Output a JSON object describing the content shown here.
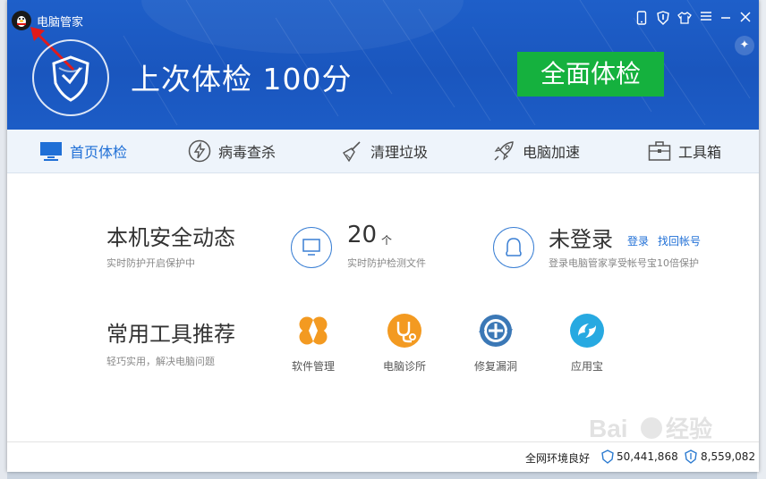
{
  "app": {
    "title": "电脑管家",
    "window_buttons": [
      "phone-icon",
      "shield-icon",
      "shirt-icon",
      "menu-icon",
      "minimize-icon",
      "close-icon"
    ]
  },
  "header": {
    "score_text": "上次体检 100分",
    "scan_button": "全面体检"
  },
  "tabs": [
    {
      "label": "首页体检",
      "icon": "monitor-icon",
      "active": true
    },
    {
      "label": "病毒查杀",
      "icon": "lightning-icon",
      "active": false
    },
    {
      "label": "清理垃圾",
      "icon": "broom-icon",
      "active": false
    },
    {
      "label": "电脑加速",
      "icon": "rocket-icon",
      "active": false
    },
    {
      "label": "工具箱",
      "icon": "toolbox-icon",
      "active": false
    }
  ],
  "security": {
    "title": "本机安全动态",
    "subtitle": "实时防护开启保护中",
    "file_count": "20",
    "file_unit": "个",
    "file_caption": "实时防护检测文件",
    "login_status": "未登录",
    "login_link": "登录",
    "recover_link": "找回帐号",
    "login_caption": "登录电脑管家享受帐号宝10倍保护"
  },
  "tools": {
    "title": "常用工具推荐",
    "subtitle": "轻巧实用，解决电脑问题",
    "items": [
      {
        "label": "软件管理",
        "icon": "clover-icon",
        "color": "#f39a21"
      },
      {
        "label": "电脑诊所",
        "icon": "stethoscope-icon",
        "color": "#f39a21"
      },
      {
        "label": "修复漏洞",
        "icon": "repair-icon",
        "color": "#3b78b6"
      },
      {
        "label": "应用宝",
        "icon": "app-store-icon",
        "color": "#27a9e1"
      }
    ]
  },
  "status": {
    "network": "全网环境良好",
    "count1": "50,441,868",
    "count2": "8,559,082"
  },
  "colors": {
    "header_blue": "#1a56be",
    "scan_green": "#15b13e",
    "accent_blue": "#1f6fd6",
    "orange": "#f39a21"
  }
}
